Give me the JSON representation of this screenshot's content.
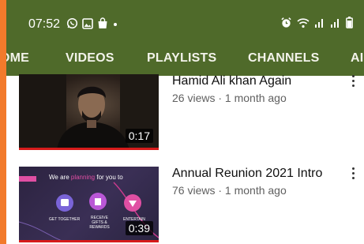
{
  "status_bar": {
    "time": "07:52",
    "left_icons": [
      "whatsapp-icon",
      "gallery-icon",
      "bag-icon",
      "dot-icon"
    ],
    "right_icons": [
      "alarm-icon",
      "wifi-icon",
      "signal-icon",
      "signal-icon",
      "battery-icon"
    ]
  },
  "tabs": [
    {
      "label": "OME"
    },
    {
      "label": "VIDEOS"
    },
    {
      "label": "PLAYLISTS"
    },
    {
      "label": "CHANNELS"
    },
    {
      "label": "AI"
    }
  ],
  "videos": [
    {
      "title": "Hamid Ali khan Again",
      "meta": "26 views · 1 month ago",
      "duration": "0:17"
    },
    {
      "title": "Annual Reunion 2021 Intro",
      "meta": "76 views · 1 month ago",
      "duration": "0:39",
      "thumb_text": {
        "headline_a": "We are ",
        "headline_b": "planning",
        "headline_c": " for you to",
        "items": [
          "GET TOGETHER",
          "RECEIVE GIFTS & REWARDS",
          "ENTERTAIN"
        ]
      }
    }
  ],
  "colors": {
    "header_bg": "#4f6a2a",
    "outer_bg": "#f27a2b",
    "progress": "#d61b1b"
  }
}
